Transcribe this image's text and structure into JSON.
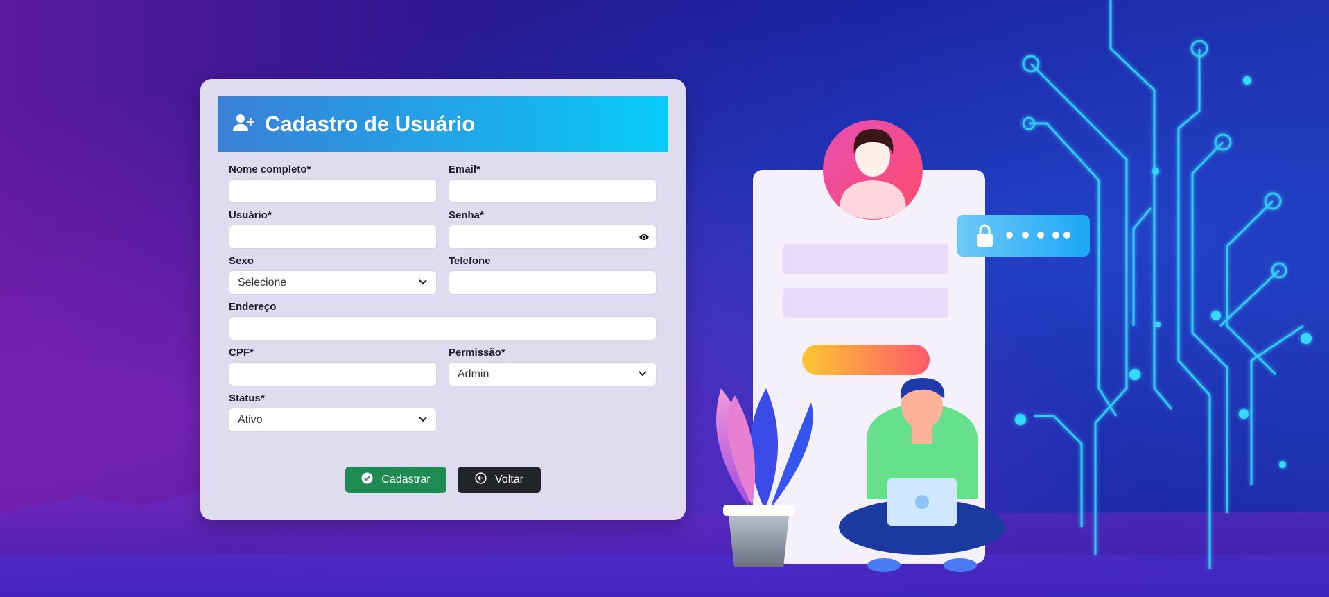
{
  "form": {
    "title": "Cadastro de Usuário",
    "fields": {
      "nome": {
        "label": "Nome completo*",
        "value": "",
        "placeholder": ""
      },
      "email": {
        "label": "Email*",
        "value": "",
        "placeholder": ""
      },
      "usuario": {
        "label": "Usuário*",
        "value": "",
        "placeholder": ""
      },
      "senha": {
        "label": "Senha*",
        "value": "",
        "placeholder": ""
      },
      "sexo": {
        "label": "Sexo",
        "selected": "Selecione"
      },
      "telefone": {
        "label": "Telefone",
        "value": "",
        "placeholder": ""
      },
      "endereco": {
        "label": "Endereço",
        "value": "",
        "placeholder": ""
      },
      "cpf": {
        "label": "CPF*",
        "value": "",
        "placeholder": ""
      },
      "permissao": {
        "label": "Permissão*",
        "selected": "Admin"
      },
      "status": {
        "label": "Status*",
        "selected": "Ativo"
      }
    },
    "buttons": {
      "submit": "Cadastrar",
      "back": "Voltar"
    }
  },
  "colors": {
    "header_start": "#3a7fd6",
    "header_end": "#07ccfb",
    "submit_bg": "#1f8a52",
    "back_bg": "#212529",
    "card_bg": "#dedcee",
    "circuit": "#35d8ff"
  },
  "icons": {
    "header": "user-plus-icon",
    "password_toggle": "eye-icon",
    "submit": "check-circle-icon",
    "back": "arrow-left-circle-icon",
    "select": "chevron-down-icon"
  }
}
